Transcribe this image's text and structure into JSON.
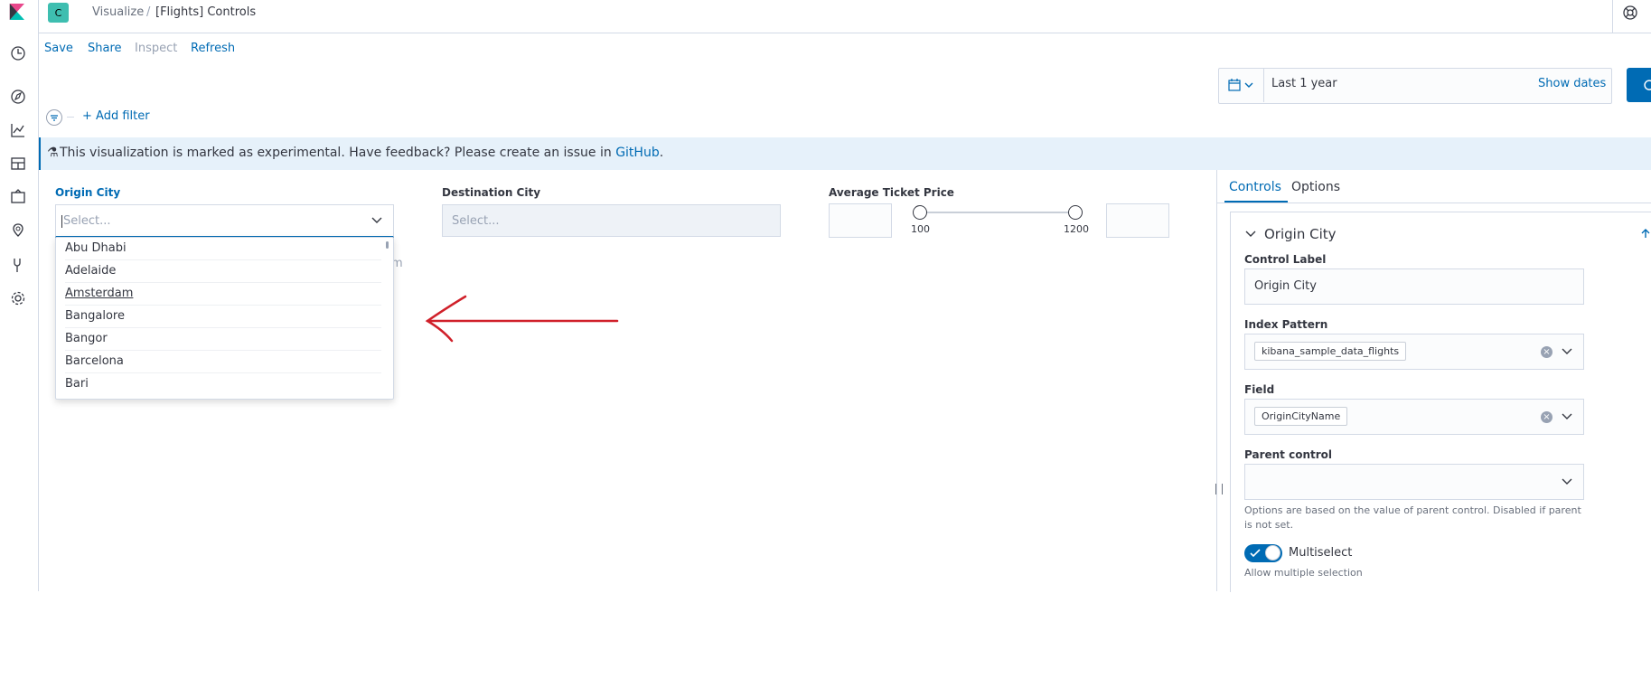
{
  "header": {
    "app_badge": "C",
    "breadcrumbs": [
      "Visualize",
      "/",
      "[Flights] Controls"
    ]
  },
  "nav": {
    "icons": [
      "kibana-logo-icon",
      "clock-icon",
      "compass-icon",
      "chart-icon",
      "dashboard-icon",
      "canvas-icon",
      "maps-icon",
      "devtools-icon",
      "gear-icon"
    ]
  },
  "toolbar": {
    "save_label": "Save",
    "share_label": "Share",
    "inspect_label": "Inspect",
    "refresh_label": "Refresh"
  },
  "datepicker": {
    "range": "Last 1 year",
    "show_dates_label": "Show dates"
  },
  "filter": {
    "add_filter_label": "+ Add filter"
  },
  "callout": {
    "text": "This visualization is marked as experimental. Have feedback? Please create an issue in ",
    "link": "GitHub",
    "end": "."
  },
  "controls": {
    "origin": {
      "label": "Origin City",
      "placeholder": "Select..."
    },
    "destination": {
      "label": "Destination City",
      "placeholder": "Select..."
    },
    "price": {
      "label": "Average Ticket Price",
      "min": "100",
      "max": "1200"
    },
    "partial_hidden_text": "m"
  },
  "dropdown": {
    "options": [
      "Abu Dhabi",
      "Adelaide",
      "Amsterdam",
      "Bangalore",
      "Bangor",
      "Barcelona",
      "Bari"
    ]
  },
  "panel": {
    "tabs": [
      "Controls",
      "Options"
    ],
    "section_title": "Origin City",
    "control_label_title": "Control Label",
    "control_label_value": "Origin City",
    "index_pattern_title": "Index Pattern",
    "index_pattern_value": "kibana_sample_data_flights",
    "field_title": "Field",
    "field_value": "OriginCityName",
    "parent_control_title": "Parent control",
    "parent_help": "Options are based on the value of parent control. Disabled if parent is not set.",
    "multiselect_label": "Multiselect",
    "multiselect_help": "Allow multiple selection"
  },
  "colors": {
    "accent": "#006bb4",
    "brand_badge": "#3ebeb0",
    "annotation_arrow": "#d0202a"
  }
}
